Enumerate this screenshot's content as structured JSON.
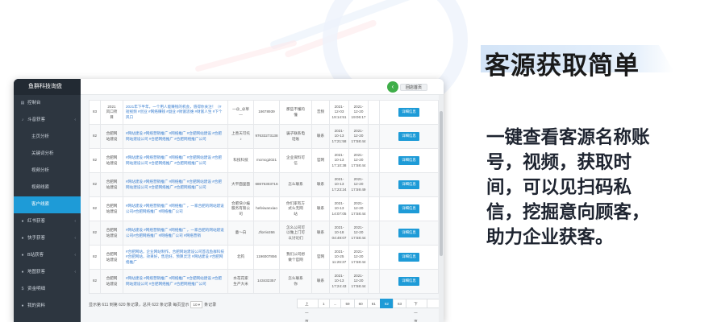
{
  "app": {
    "title": "鱼群科技询盘"
  },
  "topbar": {
    "home_label": "回店首页"
  },
  "sidebar": {
    "items": [
      {
        "label": "控制台",
        "icon": "dashboard-icon",
        "active": false,
        "indent": false,
        "caret": false
      },
      {
        "label": "斗音获客",
        "icon": "douyin-icon",
        "active": false,
        "indent": false,
        "caret": true
      },
      {
        "label": "主页分析",
        "active": false,
        "indent": true,
        "caret": false
      },
      {
        "label": "关键词分析",
        "active": false,
        "indent": true,
        "caret": false
      },
      {
        "label": "视频分析",
        "active": false,
        "indent": true,
        "caret": false
      },
      {
        "label": "视频线索",
        "active": false,
        "indent": true,
        "caret": false
      },
      {
        "label": "客户线索",
        "active": true,
        "indent": true,
        "caret": false
      },
      {
        "label": "红书获客",
        "icon": "redbook-icon",
        "active": false,
        "indent": false,
        "caret": true
      },
      {
        "label": "快手获客",
        "icon": "kuaishou-icon",
        "active": false,
        "indent": false,
        "caret": true
      },
      {
        "label": "B站获客",
        "icon": "bilibili-icon",
        "active": false,
        "indent": false,
        "caret": true
      },
      {
        "label": "地图获客",
        "icon": "map-icon",
        "active": false,
        "indent": false,
        "caret": true
      },
      {
        "label": "资金明细",
        "icon": "money-icon",
        "active": false,
        "indent": false,
        "caret": false
      },
      {
        "label": "我的资料",
        "icon": "user-icon",
        "active": false,
        "indent": false,
        "caret": false
      }
    ]
  },
  "table": {
    "detail_label": "详细信息",
    "rows": [
      {
        "id": "83",
        "name": "2021\n风口项\n目",
        "desc": "2021年下半年，一个用人能赚钱的机会，值得你关注！（#短视频 #创业 #网络赚钱 #副业 #财富思维 #财富人生 #下个风口",
        "account": "一@_@草\n—",
        "number": "18678939",
        "fans": "那些不懂的\n懂",
        "source": "音频",
        "created": "2021-\n12-03\n19:14:51",
        "updated": "2021-\n12-20\n19:06:17"
      },
      {
        "id": "82",
        "name": "合肥网\n站建设",
        "desc": "#网站建设 #网络营销推广 #网络推广 #合肥网站建设 #合肥网站建设公司 #合肥网络推广 #合肥网络推广公司",
        "account": "上善天可托\n♪",
        "number": "97633273138",
        "fans": "骗子联系电\n话账",
        "source": "联系",
        "created": "2021-\n10-13\n17:21:58",
        "updated": "2021-\n12-20\n17:58:44"
      },
      {
        "id": "82",
        "name": "合肥网\n站建设",
        "desc": "#网站建设 #网络营销推广 #网络推广 #合肥网站建设 #合肥网站建设公司 #合肥网络推广 #合肥网络推广公司",
        "account": "科技科技",
        "number": "mcmcg2021",
        "fans": "企业资料可\n信",
        "source": "官网",
        "created": "2021-\n10-13\n17:10:38",
        "updated": "2021-\n12-20\n17:58:44"
      },
      {
        "id": "82",
        "name": "合肥网\n站建设",
        "desc": "#网站建设 #网络营销推广 #网络推广 #合肥网站建设 #合肥网站建设公司 #合肥网络推广 #合肥网络推广公司",
        "account": "大平面里面",
        "number": "68675303716",
        "fans": "怎么联系",
        "source": "联系",
        "created": "2021-\n10-13\n17:23:24",
        "updated": "2021-\n12-20\n17:59:49"
      },
      {
        "id": "82",
        "name": "合肥网\n站建设",
        "desc": "#网站建设 #网络营销推广 #网络推广 ，一家合肥的网站建设公司#合肥网络推广 #网络推广公司",
        "account": "合肥快小编\n服务有限公\n司",
        "number": "hefeiwanxiao",
        "fans": "你们家有方\n式么无网\n站",
        "source": "联系",
        "created": "2021-\n10-13\n14:07:05",
        "updated": "2021-\n12-20\n17:58:44"
      },
      {
        "id": "82",
        "name": "合肥网\n站建设",
        "desc": "#网站建设 #网络营销推广 #网络推广 ，一家合肥的网站建设公司#合肥网络推广 #网络推广公司 #网络营销",
        "account": "童～白",
        "number": "Jforrie266",
        "fans": "怎么公司可\n以做上门可\n以讨论们",
        "source": "联系",
        "created": "2021-\n10-18\n04:49:07",
        "updated": "2021-\n12-20\n17:58:44"
      },
      {
        "id": "82",
        "name": "合肥网\n站建设",
        "desc": "#合肥网站，企业网站制作，合肥网站建设公司首选鱼群科技 #合肥网站，效果好，售后好，预算灵活 #网站建设 #合肥网络推广",
        "account": "北钨",
        "number": "1196007856",
        "fans": "我们公司想\n做个官网",
        "source": "官网",
        "created": "2021-\n10-25\n11:26:37",
        "updated": "2021-\n12-20\n17:58:44"
      },
      {
        "id": "82",
        "name": "合肥网\n站建设",
        "desc": "#网站建设 #网络营销推广 #网络推广 #合肥网站建设 #合肥网站建设公司 #合肥网络推广 #合肥网络推广公司",
        "account": "水花花家\n生产大米",
        "number": "143432357",
        "fans": "怎么联系\n你",
        "source": "联系",
        "created": "2021-\n10-13\n17:24:43",
        "updated": "2021-\n12-20\n17:58:44"
      }
    ]
  },
  "footer": {
    "info_prefix": "显示第 611 到第 620 条记录，总共 622 条记录 每页显示",
    "page_size": "10",
    "info_suffix": "条记录"
  },
  "pagination": {
    "items": [
      {
        "label": "上一页",
        "active": false,
        "wide": true
      },
      {
        "label": "1",
        "active": false,
        "wide": false
      },
      {
        "label": "...",
        "active": false,
        "wide": false
      },
      {
        "label": "59",
        "active": false,
        "wide": false
      },
      {
        "label": "60",
        "active": false,
        "wide": false
      },
      {
        "label": "61",
        "active": false,
        "wide": false
      },
      {
        "label": "62",
        "active": true,
        "wide": false
      },
      {
        "label": "63",
        "active": false,
        "wide": false
      },
      {
        "label": "下一页",
        "active": false,
        "wide": true
      },
      {
        "label": "",
        "active": false,
        "wide": false
      },
      {
        "label": "跳转",
        "active": false,
        "wide": false
      }
    ]
  },
  "promo": {
    "headline": "客源获取简单",
    "lines": [
      "一键查看客源名称账",
      "号，视频，获取时",
      "间，可以见扫码私",
      "信，挖掘意向顾客，",
      "助力企业获客。"
    ]
  },
  "colors": {
    "accent": "#1e9bd7",
    "sidebar_bg": "#2d3640",
    "home_button": "#3fae49"
  }
}
